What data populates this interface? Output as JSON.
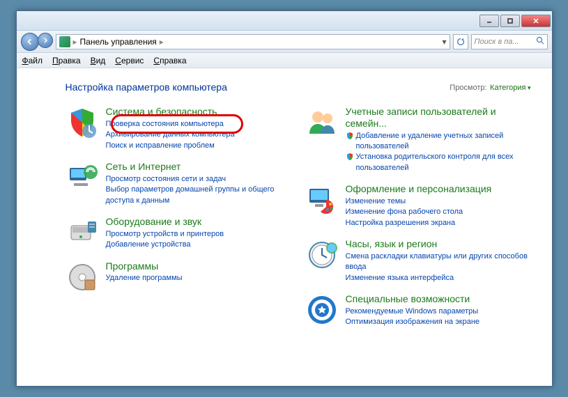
{
  "breadcrumb": {
    "root": "Панель управления"
  },
  "search": {
    "placeholder": "Поиск в па..."
  },
  "menu": {
    "file": "Файл",
    "edit": "Правка",
    "view": "Вид",
    "tools": "Сервис",
    "help": "Справка"
  },
  "heading": "Настройка параметров компьютера",
  "view_by": {
    "label": "Просмотр:",
    "value": "Категория"
  },
  "left": [
    {
      "title": "Система и безопасность",
      "links": [
        "Проверка состояния компьютера",
        "Архивирование данных компьютера",
        "Поиск и исправление проблем"
      ]
    },
    {
      "title": "Сеть и Интернет",
      "links": [
        "Просмотр состояния сети и задач",
        "Выбор параметров домашней группы и общего доступа к данным"
      ]
    },
    {
      "title": "Оборудование и звук",
      "links": [
        "Просмотр устройств и принтеров",
        "Добавление устройства"
      ]
    },
    {
      "title": "Программы",
      "links": [
        "Удаление программы"
      ]
    }
  ],
  "right": [
    {
      "title": "Учетные записи пользователей и семейн...",
      "shield_links": [
        "Добавление и удаление учетных записей пользователей",
        "Установка родительского контроля для всех пользователей"
      ]
    },
    {
      "title": "Оформление и персонализация",
      "links": [
        "Изменение темы",
        "Изменение фона рабочего стола",
        "Настройка разрешения экрана"
      ]
    },
    {
      "title": "Часы, язык и регион",
      "links": [
        "Смена раскладки клавиатуры или других способов ввода",
        "Изменение языка интерфейса"
      ]
    },
    {
      "title": "Специальные возможности",
      "links": [
        "Рекомендуемые Windows параметры",
        "Оптимизация изображения на экране"
      ]
    }
  ]
}
